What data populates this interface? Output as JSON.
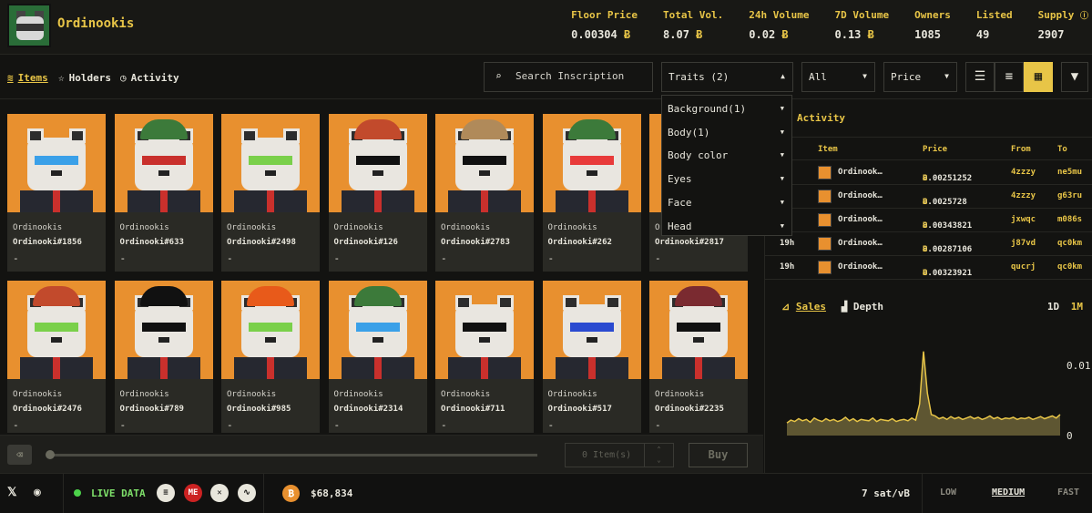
{
  "header": {
    "collection_name": "Ordinookis",
    "stats": [
      {
        "label": "Floor Price",
        "value": "0.00304",
        "unit": "Ƀ"
      },
      {
        "label": "Total Vol.",
        "value": "8.07",
        "unit": "Ƀ"
      },
      {
        "label": "24h Volume",
        "value": "0.02",
        "unit": "Ƀ"
      },
      {
        "label": "7D Volume",
        "value": "0.13",
        "unit": "Ƀ"
      },
      {
        "label": "Owners",
        "value": "1085",
        "unit": ""
      },
      {
        "label": "Listed",
        "value": "49",
        "unit": ""
      },
      {
        "label": "Supply",
        "value": "2907",
        "unit": ""
      }
    ]
  },
  "tabs": {
    "items": "Items",
    "holders": "Holders",
    "activity": "Activity"
  },
  "controls": {
    "search_placeholder": "Search Inscription",
    "traits": "Traits (2)",
    "filter_all": "All",
    "sort": "Price"
  },
  "traits_dropdown": [
    "Background(1)",
    "Body(1)",
    "Body color",
    "Eyes",
    "Face",
    "Head"
  ],
  "cards": [
    {
      "collection": "Ordinookis",
      "name": "Ordinooki#1856",
      "price": "-",
      "hat": "",
      "eyes": "#3aa0e8"
    },
    {
      "collection": "Ordinookis",
      "name": "Ordinooki#633",
      "price": "-",
      "hat": "#3c7a3a",
      "eyes": "#c9302c"
    },
    {
      "collection": "Ordinookis",
      "name": "Ordinooki#2498",
      "price": "-",
      "hat": "",
      "eyes": "#7ad04a"
    },
    {
      "collection": "Ordinookis",
      "name": "Ordinooki#126",
      "price": "-",
      "hat": "#c24a2c",
      "eyes": "#111111"
    },
    {
      "collection": "Ordinookis",
      "name": "Ordinooki#2783",
      "price": "-",
      "hat": "#b08a5a",
      "eyes": "#111111"
    },
    {
      "collection": "Ordinookis",
      "name": "Ordinooki#262",
      "price": "-",
      "hat": "#3c7a3a",
      "eyes": "#e83a3a"
    },
    {
      "collection": "Ordinookis",
      "name": "Ordinooki#2817",
      "price": "-",
      "hat": "#3c7a3a",
      "eyes": "#111111"
    },
    {
      "collection": "Ordinookis",
      "name": "Ordinooki#2476",
      "price": "-",
      "hat": "#c24a2c",
      "eyes": "#7ad04a"
    },
    {
      "collection": "Ordinookis",
      "name": "Ordinooki#789",
      "price": "-",
      "hat": "#111111",
      "eyes": "#111111"
    },
    {
      "collection": "Ordinookis",
      "name": "Ordinooki#985",
      "price": "-",
      "hat": "#e85a1a",
      "eyes": "#7ad04a"
    },
    {
      "collection": "Ordinookis",
      "name": "Ordinooki#2314",
      "price": "-",
      "hat": "#3c7a3a",
      "eyes": "#3aa0e8"
    },
    {
      "collection": "Ordinookis",
      "name": "Ordinooki#711",
      "price": "-",
      "hat": "",
      "eyes": "#111111"
    },
    {
      "collection": "Ordinookis",
      "name": "Ordinooki#517",
      "price": "-",
      "hat": "",
      "eyes": "#2a4ad0"
    },
    {
      "collection": "Ordinookis",
      "name": "Ordinooki#2235",
      "price": "-",
      "hat": "#7a2a30",
      "eyes": "#111111"
    }
  ],
  "cart": {
    "quantity": "0 Item(s)",
    "buy_label": "Buy"
  },
  "activity": {
    "title": "Activity",
    "columns": [
      "Item",
      "Price",
      "From",
      "To"
    ],
    "rows": [
      {
        "time": "",
        "item": "Ordinook…",
        "price": "0.00251252",
        "from": "4zzzy",
        "to": "ne5mu"
      },
      {
        "time": "",
        "item": "Ordinook…",
        "price": "0.0025728",
        "from": "4zzzy",
        "to": "g63ru"
      },
      {
        "time": "",
        "item": "Ordinook…",
        "price": "0.00343821",
        "from": "jxwqc",
        "to": "m086s"
      },
      {
        "time": "19h",
        "item": "Ordinook…",
        "price": "0.00287106",
        "from": "j87vd",
        "to": "qc0km"
      },
      {
        "time": "19h",
        "item": "Ordinook…",
        "price": "0.00323921",
        "from": "qucrj",
        "to": "qc0km"
      }
    ],
    "price_unit": "Ƀ"
  },
  "chart": {
    "tab_sales": "Sales",
    "tab_depth": "Depth",
    "range_1d": "1D",
    "range_1m": "1M",
    "y_labels": [
      "0.01",
      "0"
    ]
  },
  "chart_data": {
    "type": "area",
    "ylim": [
      0,
      0.013
    ],
    "y_ticks": [
      "0.01",
      "0"
    ],
    "values": [
      0.0018,
      0.0022,
      0.002,
      0.0024,
      0.0021,
      0.0023,
      0.0019,
      0.0025,
      0.0022,
      0.002,
      0.0024,
      0.0021,
      0.0023,
      0.002,
      0.0022,
      0.0026,
      0.0021,
      0.0024,
      0.002,
      0.0023,
      0.0022,
      0.0021,
      0.0025,
      0.002,
      0.0023,
      0.0022,
      0.0021,
      0.0024,
      0.002,
      0.0022,
      0.0023,
      0.0021,
      0.0025,
      0.0022,
      0.0045,
      0.012,
      0.006,
      0.003,
      0.0028,
      0.0024,
      0.0026,
      0.0023,
      0.0027,
      0.0024,
      0.0026,
      0.0023,
      0.0025,
      0.0027,
      0.0024,
      0.0026,
      0.0023,
      0.0025,
      0.0028,
      0.0024,
      0.0026,
      0.0023,
      0.0025,
      0.0024,
      0.0026,
      0.0023,
      0.0025,
      0.0024,
      0.0026,
      0.0023,
      0.0025,
      0.0027,
      0.0024,
      0.0026,
      0.0028,
      0.0025,
      0.003
    ]
  },
  "footer": {
    "live_label": "LIVE DATA",
    "btc_price": "$68,834",
    "fee": "7 sat/vB",
    "speed_low": "LOW",
    "speed_medium": "MEDIUM",
    "speed_fast": "FAST"
  },
  "colors": {
    "accent": "#e8c547",
    "card_bg": "#e8902f",
    "live": "#4cd24a"
  }
}
